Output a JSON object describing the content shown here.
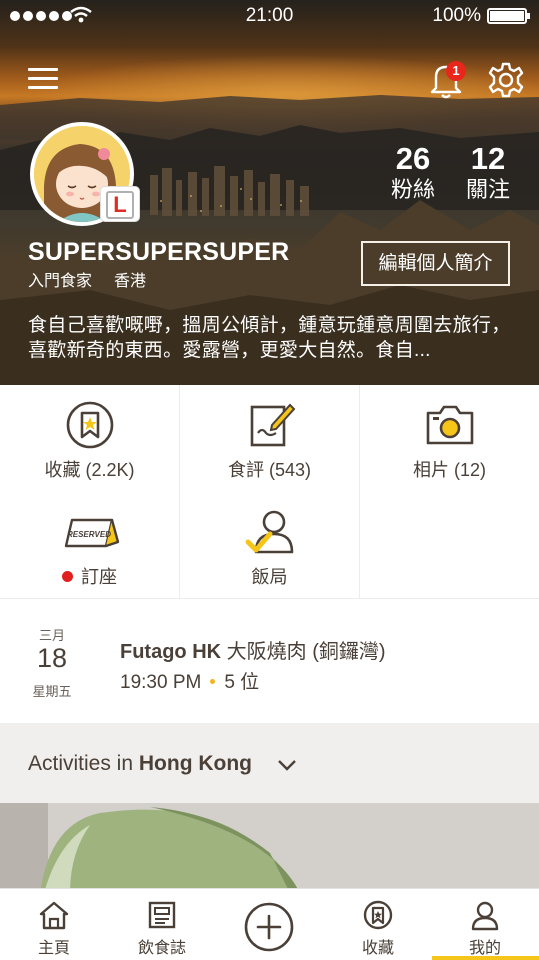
{
  "status_bar": {
    "time": "21:00",
    "battery": "100%"
  },
  "profile": {
    "notification_count": "1",
    "stats": [
      {
        "value": "26",
        "label": "粉絲"
      },
      {
        "value": "12",
        "label": "關注"
      }
    ],
    "level_badge": "L",
    "username": "SUPERSUPERSUPER",
    "rank": "入門食家",
    "location": "香港",
    "edit_button": "編輯個人簡介",
    "bio": "食自己喜歡嘅嘢，搵周公傾計，鍾意玩鍾意周圍去旅行，喜歡新奇的東西。愛露營，更愛大自然。食自..."
  },
  "grid": {
    "bookmarks": "收藏 (2.2K)",
    "reviews": "食評 (543)",
    "photos": "相片 (12)",
    "reservation_tag": "RESERVED",
    "booking": "訂座",
    "gathering": "飯局"
  },
  "booking": {
    "month": "三月",
    "day": "18",
    "weekday": "星期五",
    "restaurant_bold": "Futago HK",
    "restaurant_rest": " 大阪燒肉 (銅鑼灣)",
    "time": "19:30 PM",
    "people": "5 位"
  },
  "activities": {
    "prefix": "Activities in ",
    "city": "Hong Kong"
  },
  "tabbar": {
    "home": "主頁",
    "journal": "飲食誌",
    "bookmarks": "收藏",
    "me": "我的"
  },
  "colors": {
    "accent": "#f6c51a",
    "text": "#4a4038",
    "badge": "#e8261c",
    "reserved_dot": "#e02020"
  }
}
